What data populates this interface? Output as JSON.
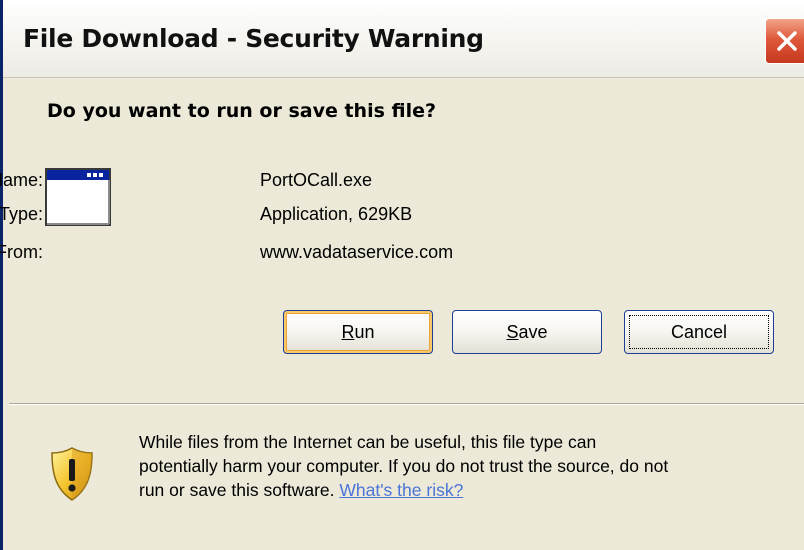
{
  "dialog": {
    "title": "File Download - Security Warning",
    "question": "Do you want to run or save this file?"
  },
  "file": {
    "name_label": "Name:",
    "name_value": "PortOCall.exe",
    "type_label": "Type:",
    "type_value": "Application, 629KB",
    "from_label": "From:",
    "from_value": "www.vadataservice.com"
  },
  "buttons": {
    "run_mnemonic": "R",
    "run_rest": "un",
    "save_mnemonic": "S",
    "save_rest": "ave",
    "cancel_label": "Cancel"
  },
  "warning": {
    "line1": "While files from the Internet can be useful, this file type can",
    "line2": "potentially harm your computer. If you do not trust the source, do not",
    "line3_text": "run or save this software. ",
    "risk_link": "What's the risk?"
  },
  "icons": {
    "close": "close-icon",
    "application": "application-window-icon",
    "warning": "warning-shield-icon"
  },
  "colors": {
    "dialog_bg": "#ece9d8",
    "close_button": "#e0593d",
    "button_border": "#1c3f94",
    "link": "#4a74d8",
    "shield_yellow": "#f4c430"
  }
}
